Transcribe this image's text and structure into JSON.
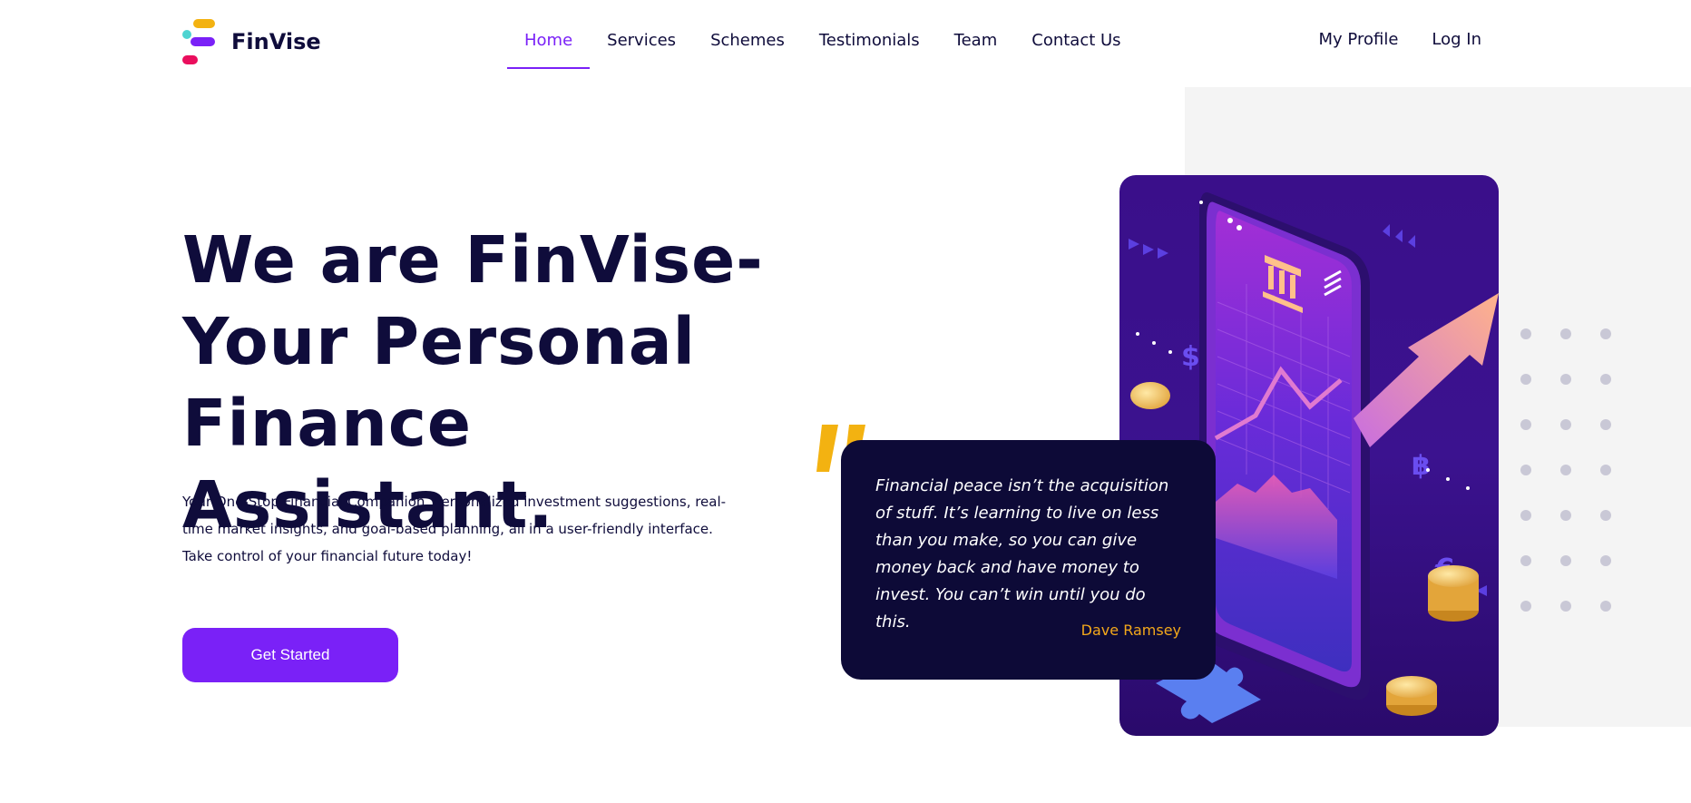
{
  "brand": {
    "name": "FinVise"
  },
  "nav": {
    "items": [
      {
        "label": "Home",
        "active": true
      },
      {
        "label": "Services"
      },
      {
        "label": "Schemes"
      },
      {
        "label": "Testimonials"
      },
      {
        "label": "Team"
      },
      {
        "label": "Contact Us"
      }
    ],
    "profile_label": "My Profile",
    "login_label": "Log In"
  },
  "hero": {
    "title_line1": "We are FinVise-",
    "title_line2": "Your Personal",
    "title_line3": "Finance Assistant.",
    "description": "Your One-Stop Financial Companion. Personalized investment suggestions, real-time market insights, and goal-based planning, all in a user-friendly interface. Take control of your financial future today!",
    "cta_label": "Get Started"
  },
  "quote": {
    "text": "Financial peace isn’t the acquisition of stuff. It’s learning to live on less than you make, so you can give money back and have money to invest. You can’t win until you do this.",
    "author": "Dave Ramsey"
  },
  "colors": {
    "accent": "#7a21f7",
    "navy": "#0f0c3b",
    "quote_author": "#f3a81b",
    "quote_mark": "#f3b211"
  }
}
